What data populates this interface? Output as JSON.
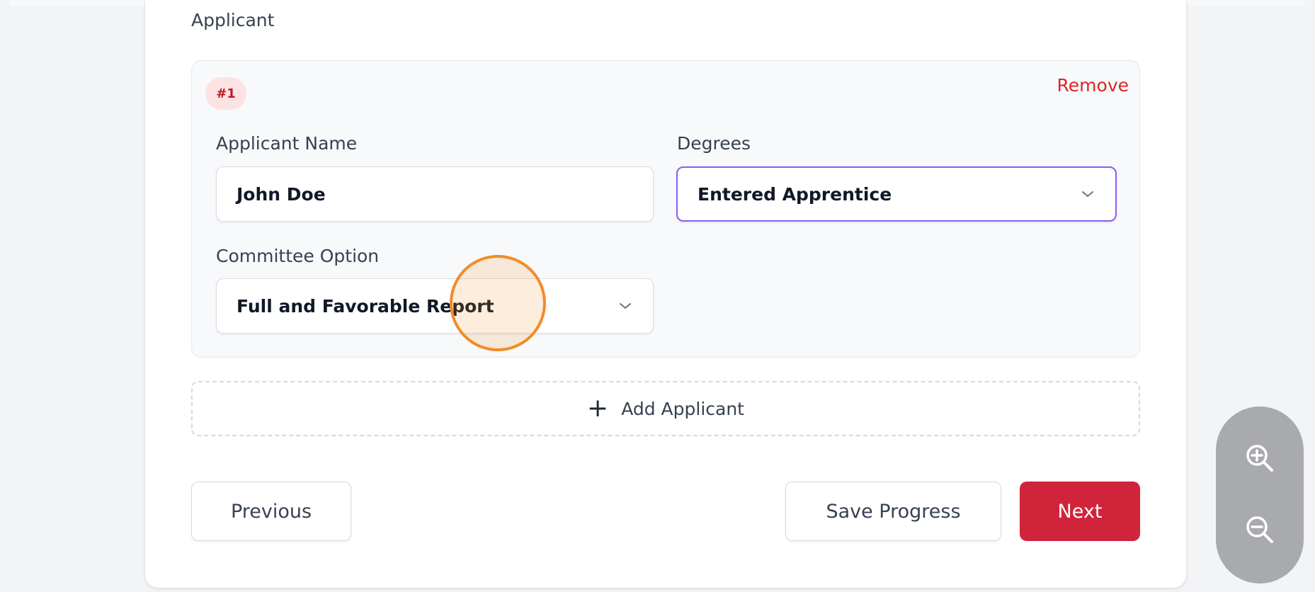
{
  "section": {
    "title": "Applicant"
  },
  "applicant": {
    "badge": "#1",
    "remove_label": "Remove",
    "name_label": "Applicant Name",
    "name_value": "John Doe",
    "degrees_label": "Degrees",
    "degrees_value": "Entered Apprentice",
    "committee_label": "Committee Option",
    "committee_value": "Full and Favorable Report"
  },
  "add_applicant": {
    "label": "Add Applicant",
    "icon": "plus-icon"
  },
  "footer": {
    "previous_label": "Previous",
    "save_label": "Save Progress",
    "next_label": "Next"
  },
  "zoom": {
    "in_icon": "zoom-in-icon",
    "out_icon": "zoom-out-icon"
  },
  "colors": {
    "accent": "#d0243b",
    "remove": "#dc2626",
    "focus": "#8b5cf6",
    "cursor_ring": "#f28c28"
  }
}
